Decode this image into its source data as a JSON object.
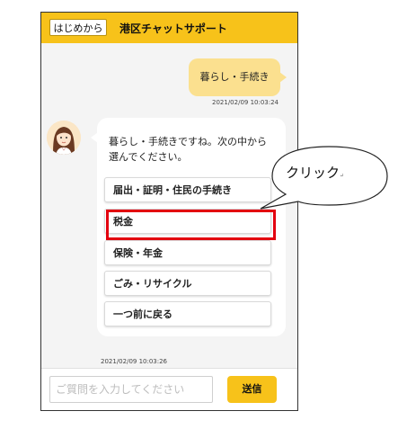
{
  "header": {
    "restart_label": "はじめから",
    "title": "港区チャットサポート"
  },
  "chat": {
    "user_message": "暮らし・手続き",
    "user_timestamp": "2021/02/09 10:03:24",
    "bot_message_line1": "暮らし・手続きですね。次の中から",
    "bot_message_line2": "選んでください。",
    "options": [
      "届出・証明・住民の手続き",
      "税金",
      "保険・年金",
      "ごみ・リサイクル",
      "一つ前に戻る"
    ],
    "bot_timestamp": "2021/02/09 10:03:26"
  },
  "footer": {
    "input_placeholder": "ご質問を入力してください",
    "send_label": "送信"
  },
  "annotation": {
    "callout_text": "クリック",
    "callout_mark": "↵",
    "highlight_color": "#e3000f"
  },
  "colors": {
    "accent": "#f7c21a",
    "user_bubble": "#fbe08f"
  }
}
